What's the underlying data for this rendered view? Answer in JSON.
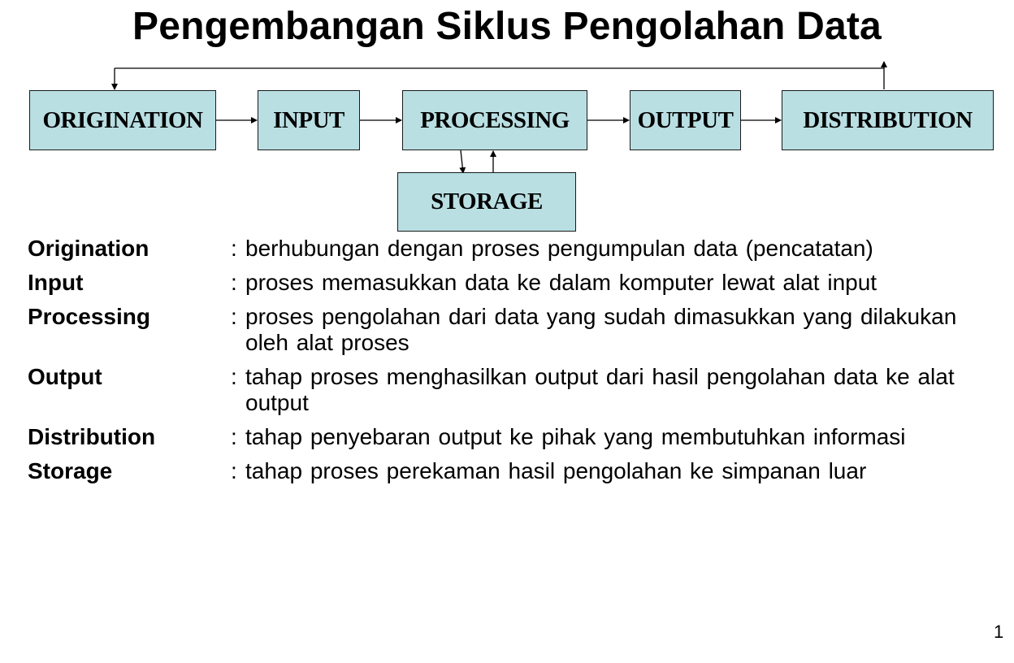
{
  "title": "Pengembangan Siklus Pengolahan Data",
  "diagram": {
    "box_fill": "#B9DFE3",
    "stages": [
      {
        "id": "origination",
        "label": "ORIGINATION"
      },
      {
        "id": "input",
        "label": "INPUT"
      },
      {
        "id": "processing",
        "label": "PROCESSING"
      },
      {
        "id": "output",
        "label": "OUTPUT"
      },
      {
        "id": "distribution",
        "label": "DISTRIBUTION"
      },
      {
        "id": "storage",
        "label": "STORAGE"
      }
    ],
    "connections": [
      {
        "from": "origination",
        "to": "input"
      },
      {
        "from": "input",
        "to": "processing"
      },
      {
        "from": "processing",
        "to": "output"
      },
      {
        "from": "output",
        "to": "distribution"
      },
      {
        "from": "processing",
        "to": "storage"
      },
      {
        "from": "storage",
        "to": "processing"
      },
      {
        "from": "distribution",
        "to": "origination",
        "note": "feedback loop"
      }
    ]
  },
  "definitions": [
    {
      "term": "Origination",
      "separator": ":",
      "text": "berhubungan dengan proses pengumpulan data (pencatatan)"
    },
    {
      "term": "Input",
      "separator": ":",
      "text": "proses memasukkan data ke dalam komputer lewat alat input"
    },
    {
      "term": "Processing",
      "separator": ":",
      "text": "proses pengolahan dari data yang sudah dimasukkan yang dilakukan oleh alat proses"
    },
    {
      "term": "Output",
      "separator": ":",
      "text": "tahap proses menghasilkan output dari hasil pengolahan data ke alat output"
    },
    {
      "term": "Distribution",
      "separator": ":",
      "text": "tahap penyebaran output ke pihak yang membutuhkan informasi"
    },
    {
      "term": "Storage",
      "separator": ":",
      "text": "tahap proses perekaman hasil pengolahan ke simpanan luar"
    }
  ],
  "page_number": "1"
}
